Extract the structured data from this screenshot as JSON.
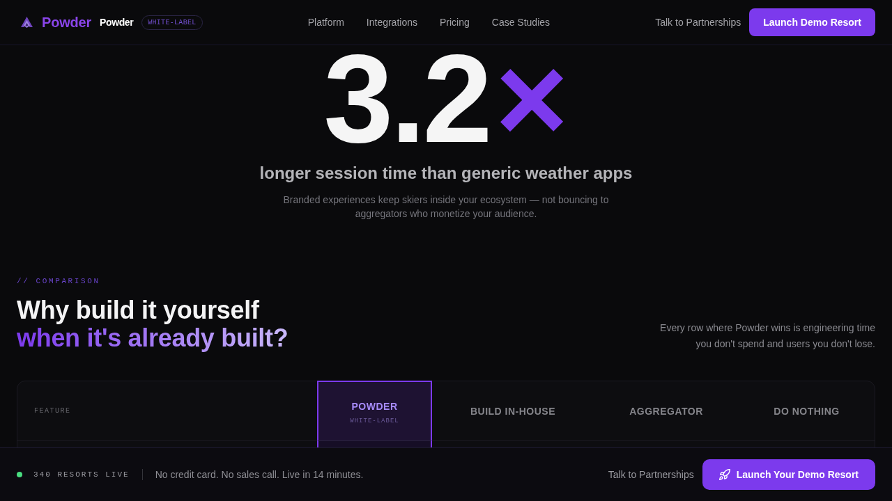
{
  "header": {
    "brand": "Powder",
    "product": "Powder",
    "badge": "WHITE-LABEL",
    "nav": [
      {
        "label": "Platform"
      },
      {
        "label": "Integrations"
      },
      {
        "label": "Pricing"
      },
      {
        "label": "Case Studies"
      }
    ],
    "secondary_link": "Talk to Partnerships",
    "cta": "Launch Demo Resort"
  },
  "stat": {
    "value": "3.2",
    "unit": "×",
    "headline": "longer session time than generic weather apps",
    "description": "Branded experiences keep skiers inside your ecosystem — not bouncing to aggregators who monetize your audience."
  },
  "comparison": {
    "eyebrow": "// COMPARISON",
    "title": "Why build it yourself",
    "title_highlight": "when it's already built?",
    "note": "Every row where Powder wins is engineering time you don't spend and users you don't lose.",
    "table": {
      "columns": [
        {
          "kind": "feature",
          "label": "FEATURE",
          "highlighted": false
        },
        {
          "kind": "option",
          "label": "POWDER",
          "sublabel": "WHITE-LABEL",
          "highlighted": true
        },
        {
          "kind": "option",
          "label": "BUILD IN-HOUSE",
          "highlighted": false
        },
        {
          "kind": "option",
          "label": "AGGREGATOR",
          "highlighted": false
        },
        {
          "kind": "option",
          "label": "DO NOTHING",
          "highlighted": false
        }
      ]
    }
  },
  "bottom_bar": {
    "live": true,
    "status": "340 RESORTS LIVE",
    "message": "No credit card. No sales call. Live in 14 minutes.",
    "link": "Talk to Partnerships",
    "cta": "Launch Your Demo Resort"
  }
}
